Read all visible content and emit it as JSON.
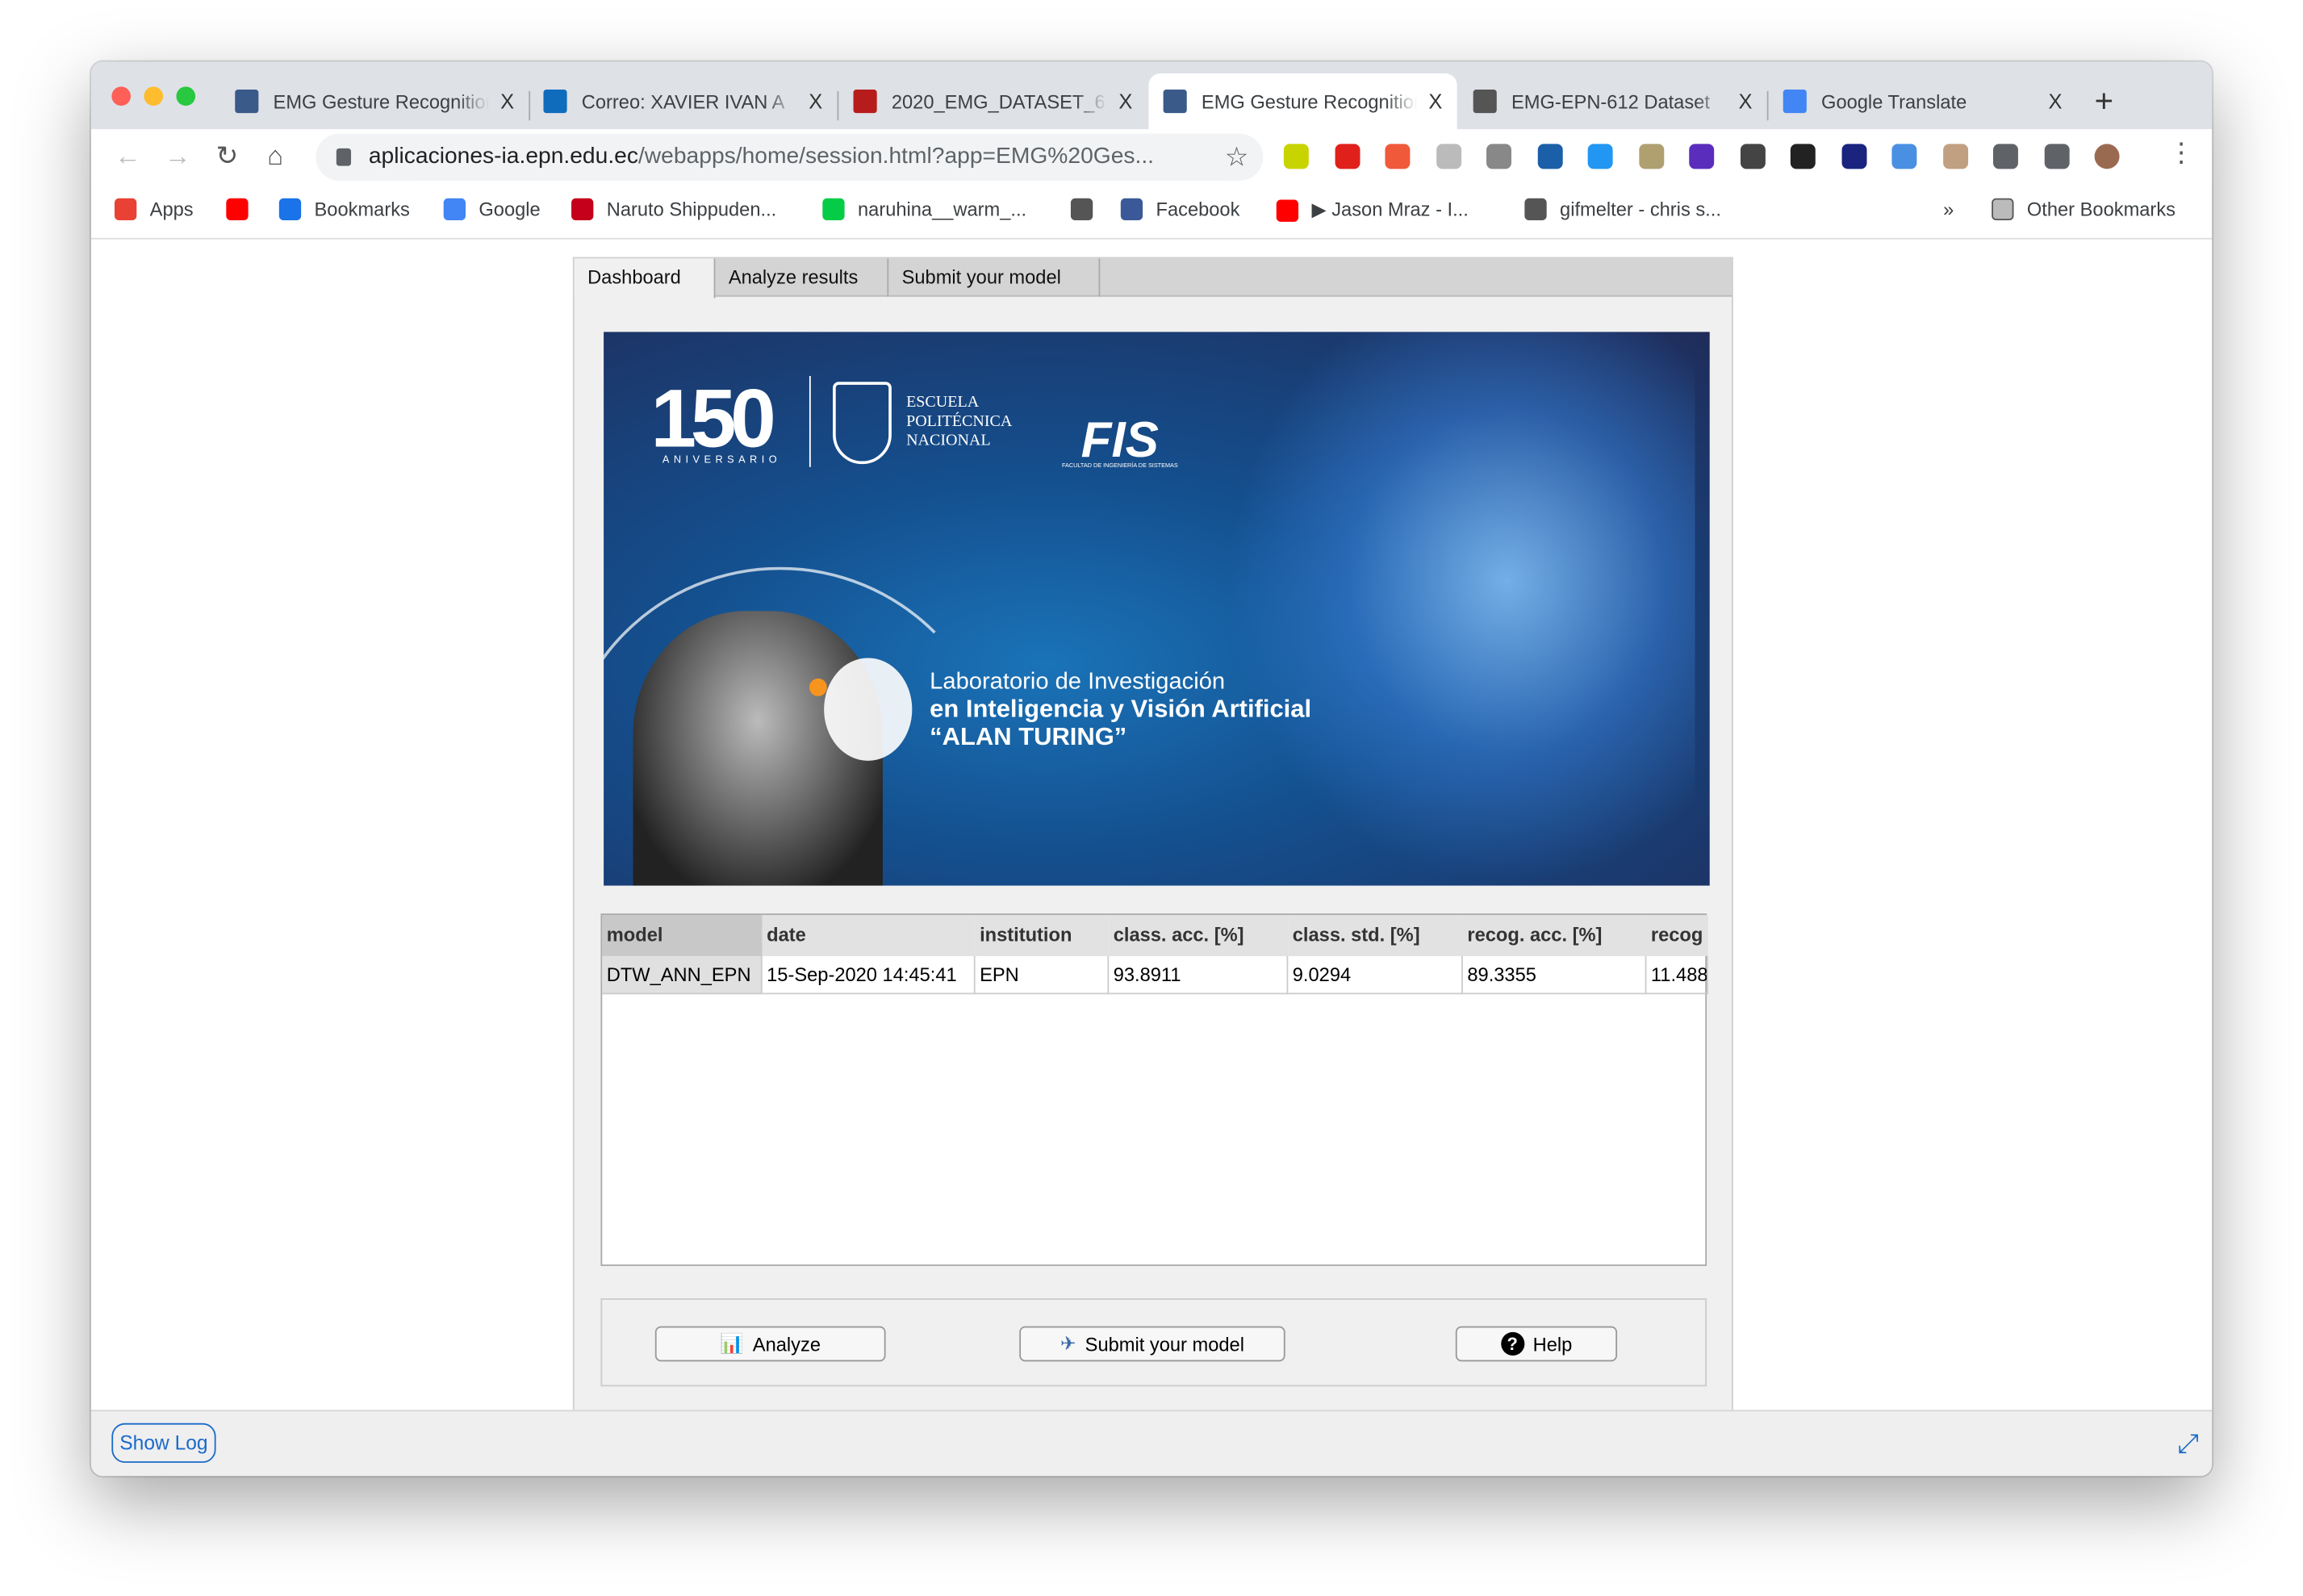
{
  "browser": {
    "tabs": [
      {
        "title": "EMG Gesture Recognition",
        "icon": "epn-app-icon",
        "color": "#3a5a8a",
        "active": false
      },
      {
        "title": "Correo: XAVIER IVAN A",
        "icon": "outlook-icon",
        "color": "#0f6cbd",
        "active": false
      },
      {
        "title": "2020_EMG_DATASET_6",
        "icon": "epn-shield-icon",
        "color": "#b71c1c",
        "active": false
      },
      {
        "title": "EMG Gesture Recognition",
        "icon": "epn-app-icon",
        "color": "#3a5a8a",
        "active": true
      },
      {
        "title": "EMG-EPN-612 Dataset",
        "icon": "globe-icon",
        "color": "#555555",
        "active": false
      },
      {
        "title": "Google Translate",
        "icon": "google-translate-icon",
        "color": "#4285f4",
        "active": false
      }
    ],
    "close_glyph": "X",
    "new_tab_glyph": "+",
    "url_host": "aplicaciones-ia.epn.edu.ec",
    "url_path": "/webapps/home/session.html?app=EMG%20Ges...",
    "extensions": [
      {
        "name": "green-plus-extension-icon",
        "color": "#c8d400"
      },
      {
        "name": "adblock-icon",
        "color": "#e0201b"
      },
      {
        "name": "off-badge-extension-icon",
        "color": "#f05a3a"
      },
      {
        "name": "document-extension-icon",
        "color": "#bbbbbb"
      },
      {
        "name": "circle-extension-icon",
        "color": "#888888"
      },
      {
        "name": "p-extension-icon",
        "color": "#1a5fa8"
      },
      {
        "name": "p-blue-extension-icon",
        "color": "#2196f3"
      },
      {
        "name": "image-download-extension-icon",
        "color": "#b0a070"
      },
      {
        "name": "diamond-extension-icon",
        "color": "#5b2dbd"
      },
      {
        "name": "dark-circle-extension-icon",
        "color": "#444444"
      },
      {
        "name": "json-extension-icon",
        "color": "#222222"
      },
      {
        "name": "eyedropper-extension-icon",
        "color": "#1a237e"
      },
      {
        "name": "blue-drop-extension-icon",
        "color": "#4a90e2"
      },
      {
        "name": "chrome-window-extension-icon",
        "color": "#c0a080"
      },
      {
        "name": "puzzle-icon",
        "color": "#5f6368"
      },
      {
        "name": "media-queue-icon",
        "color": "#5f6368"
      },
      {
        "name": "profile-avatar",
        "color": "#9a6a50"
      }
    ],
    "menu_glyph": "⋮",
    "bookmarks": [
      {
        "label": "Apps",
        "icon": "apps-grid-icon",
        "color": "#e94235"
      },
      {
        "label": "",
        "icon": "youtube-icon",
        "color": "#ff0000"
      },
      {
        "label": "Bookmarks",
        "icon": "star-icon",
        "color": "#1a73e8"
      },
      {
        "label": "Google",
        "icon": "google-icon",
        "color": "#4285f4"
      },
      {
        "label": "Naruto Shippuden...",
        "icon": "s-icon",
        "color": "#c4001a"
      },
      {
        "label": "naruhina__warm_...",
        "icon": "deviantart-icon",
        "color": "#05cc47"
      },
      {
        "label": "",
        "icon": "globe-icon",
        "color": "#555555"
      },
      {
        "label": "Facebook",
        "icon": "facebook-icon",
        "color": "#3b5998"
      },
      {
        "label": "▶ Jason Mraz - I...",
        "icon": "youtube-icon",
        "color": "#ff0000"
      },
      {
        "label": "gifmelter - chris s...",
        "icon": "globe-icon",
        "color": "#555555"
      }
    ],
    "overflow_glyph": "»",
    "other_bookmarks": "Other Bookmarks"
  },
  "app": {
    "tabs": [
      "Dashboard",
      "Analyze results",
      "Submit your model"
    ],
    "banner": {
      "anniversary_number": "150",
      "anniversary_label": "ANIVERSARIO",
      "school": [
        "ESCUELA",
        "POLITÉCNICA",
        "NACIONAL"
      ],
      "faculty_logo": "FIS",
      "faculty_name": "FACULTAD DE INGENIERÍA DE SISTEMAS",
      "lab_line1": "Laboratorio de Investigación",
      "lab_line2": "en Inteligencia y Visión Artificial",
      "lab_line3": "“ALAN TURING”"
    },
    "table": {
      "columns": [
        "model",
        "date",
        "institution",
        "class. acc. [%]",
        "class. std. [%]",
        "recog. acc. [%]",
        "recog"
      ],
      "rows": [
        [
          "DTW_ANN_EPN",
          "15-Sep-2020 14:45:41",
          "EPN",
          "93.8911",
          "9.0294",
          "89.3355",
          "11.488"
        ]
      ]
    },
    "buttons": {
      "analyze": "Analyze",
      "submit": "Submit your model",
      "help": "Help"
    },
    "show_log": "Show Log",
    "accent": "#1a6ac9"
  }
}
